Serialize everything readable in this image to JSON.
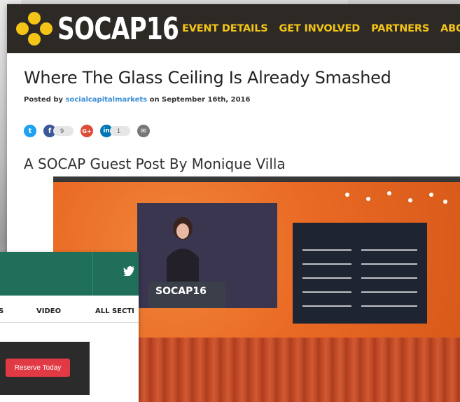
{
  "header": {
    "logo_text": "SOCAP16",
    "nav": [
      "EVENT DETAILS",
      "GET INVOLVED",
      "PARTNERS",
      "ABOUT"
    ]
  },
  "post": {
    "title": "Where The Glass Ceiling Is Already Smashed",
    "posted_prefix": "Posted by ",
    "author": "socialcapitalmarkets",
    "posted_suffix": " on September 16th, 2016",
    "subheading": "A SOCAP Guest Post By Monique Villa"
  },
  "shares": [
    {
      "icon": "twitter-icon",
      "glyph": "t",
      "color": "#1da1f2",
      "count": ""
    },
    {
      "icon": "facebook-icon",
      "glyph": "f",
      "color": "#3b5998",
      "count": "9"
    },
    {
      "icon": "google-plus-icon",
      "glyph": "G+",
      "color": "#dd4b39",
      "count": ""
    },
    {
      "icon": "linkedin-icon",
      "glyph": "in",
      "color": "#0077b5",
      "count": "1"
    },
    {
      "icon": "email-icon",
      "glyph": "✉",
      "color": "#777777",
      "count": ""
    }
  ],
  "photo": {
    "podium_logo": "SOCAP16"
  },
  "overlay": {
    "tabs": [
      "S",
      "VIDEO",
      "ALL SECTI"
    ],
    "reserve_label": "Reserve Today"
  },
  "colors": {
    "header_bg": "#2d2a26",
    "nav_accent": "#f4c417",
    "link": "#3a8ed6",
    "overlay_bar": "#1f6f5a",
    "reserve": "#e23a45"
  }
}
